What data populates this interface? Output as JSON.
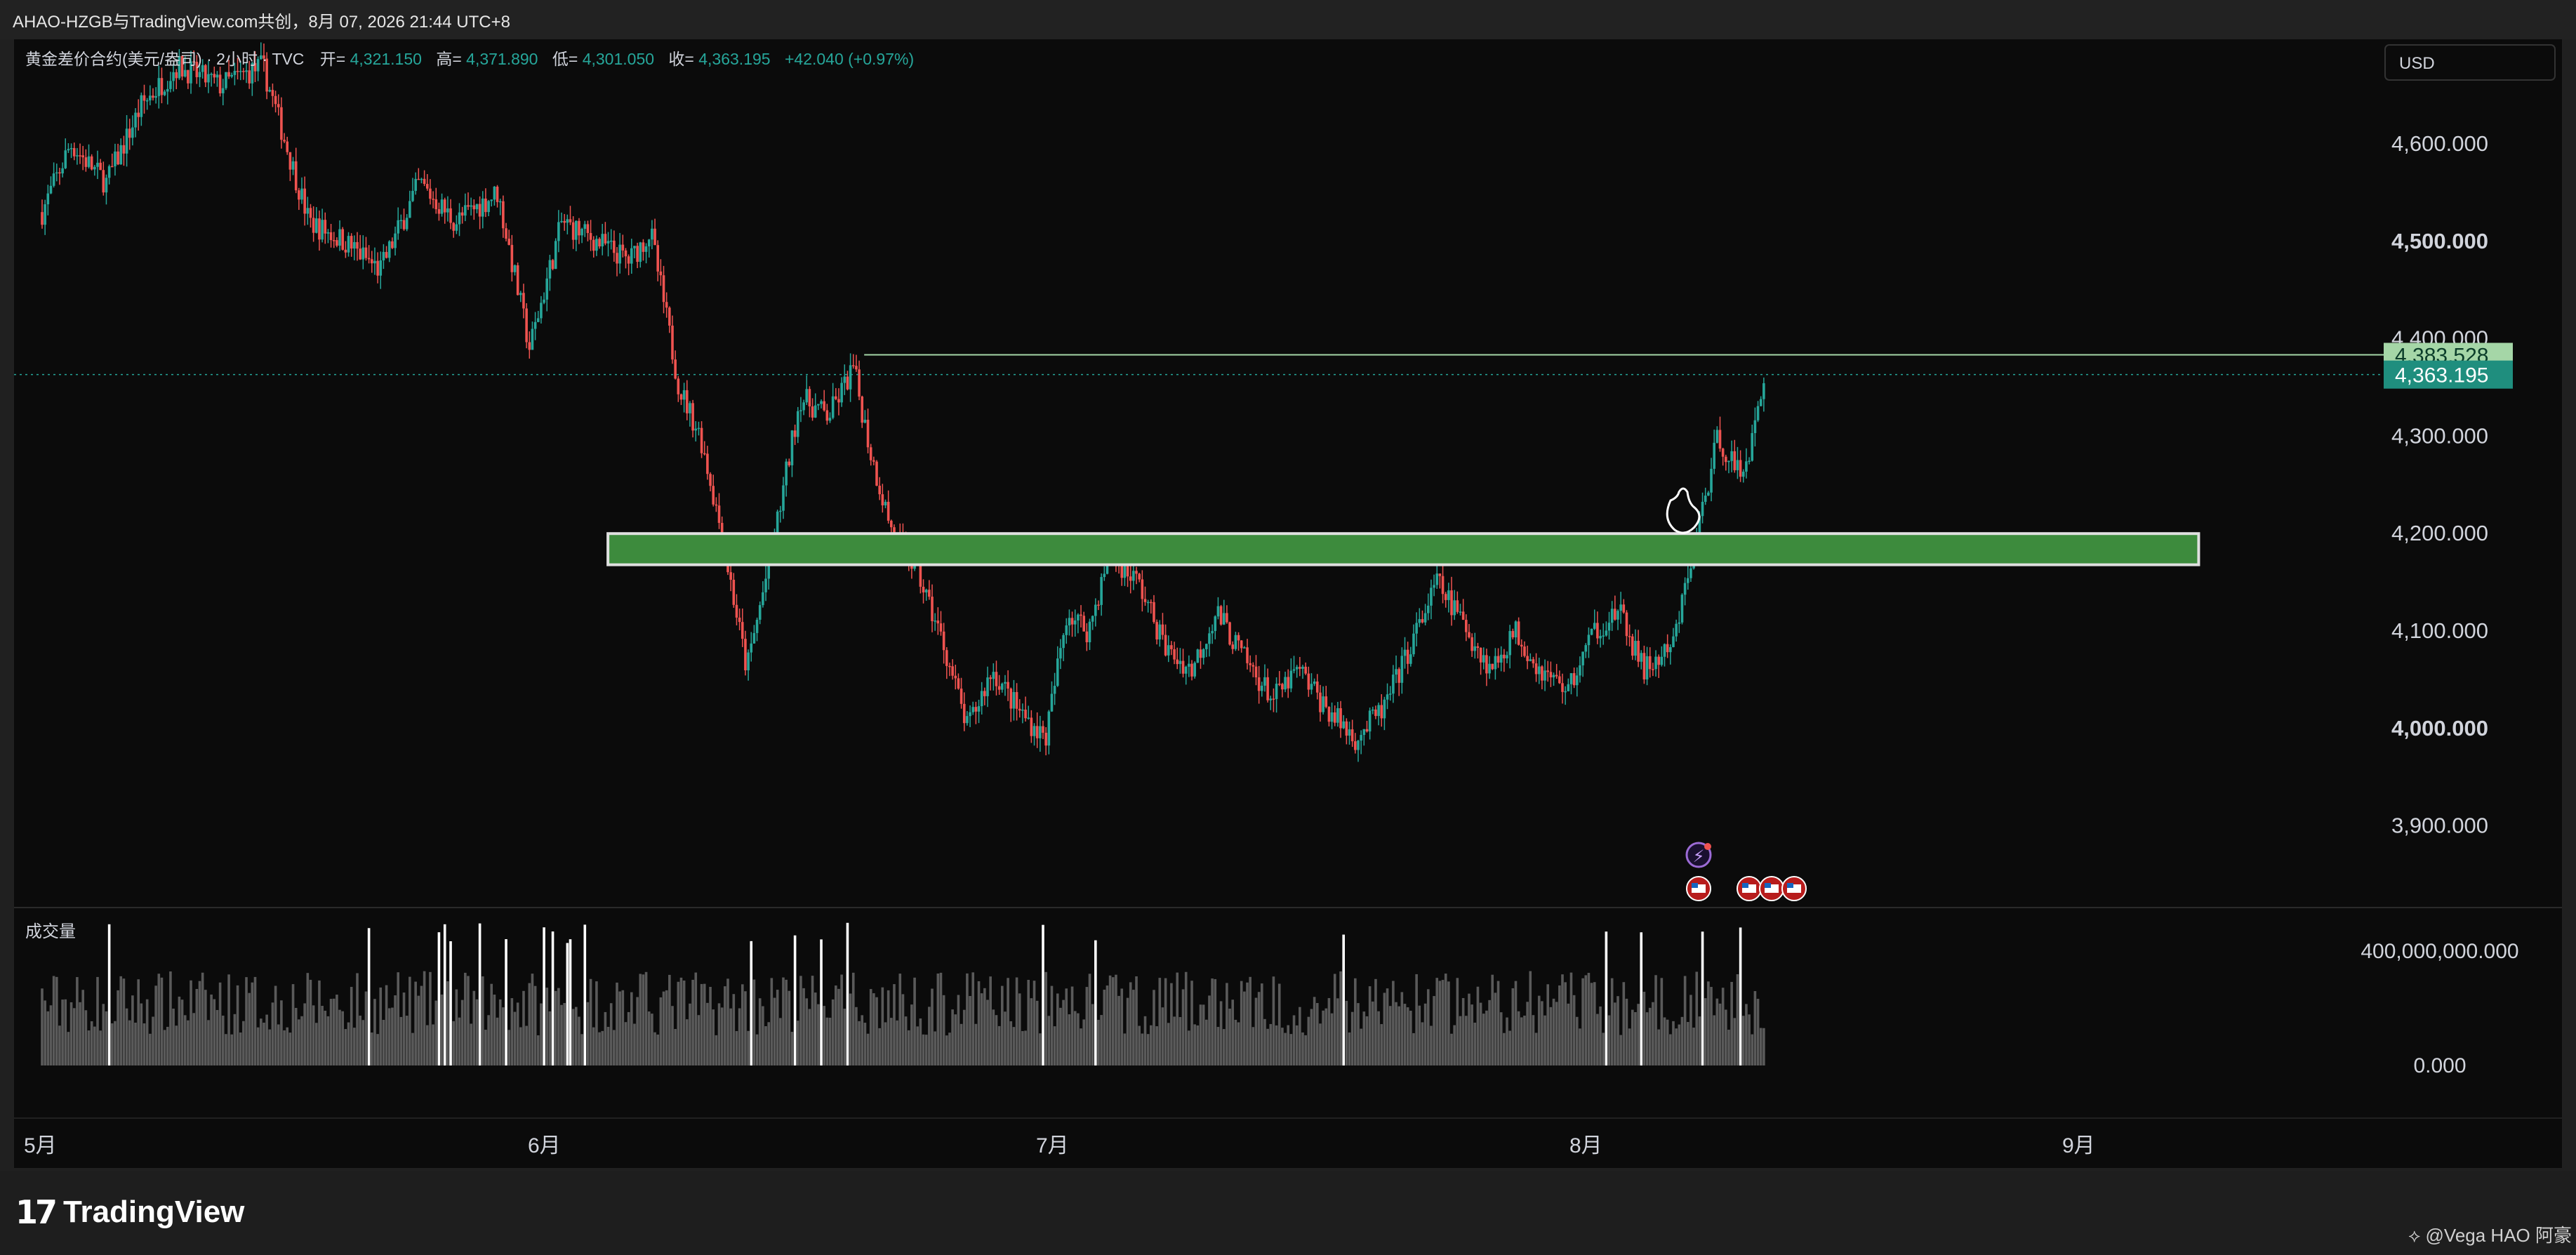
{
  "header": {
    "share_title": "AHAO-HZGB与TradingView.com共创，8月 07, 2026 21:44 UTC+8"
  },
  "legend": {
    "symbol": "黄金差价合约(美元/盎司) · 2小时 · TVC",
    "open_label": "开=",
    "open_value": "4,321.150",
    "high_label": "高=",
    "high_value": "4,371.890",
    "low_label": "低=",
    "low_value": "4,301.050",
    "close_label": "收=",
    "close_value": "4,363.195",
    "change": "+42.040 (+0.97%)"
  },
  "currency_box": "USD",
  "volume_label": "成交量",
  "colors": {
    "background": "#0b0b0b",
    "up": "#26a69a",
    "down": "#ef5350",
    "zone_fill": "#3d8b3d",
    "zone_border": "#e0e0e0",
    "resistance_line": "#a5d6a7",
    "last_price_bg": "#1f8e7e",
    "resistance_label_bg": "#a5d6a7"
  },
  "chart_data": [
    {
      "type": "candlestick",
      "interval": "2小时",
      "y_axis_ticks": [
        "3,900.000",
        "4,000.000",
        "4,100.000",
        "4,200.000",
        "4,300.000",
        "4,400.000",
        "4,500.000",
        "4,600.000"
      ],
      "y_tick_values": [
        3900,
        4000,
        4100,
        4200,
        4300,
        4400,
        4500,
        4600
      ],
      "ylim": [
        3840,
        4700
      ],
      "x_axis_ticks": [
        "5月",
        "6月",
        "7月",
        "8月",
        "9月"
      ],
      "price_path": [
        [
          0.0,
          4530
        ],
        [
          0.8,
          4600
        ],
        [
          1.8,
          4560
        ],
        [
          2.8,
          4640
        ],
        [
          3.8,
          4680
        ],
        [
          5.0,
          4660
        ],
        [
          6.2,
          4680
        ],
        [
          7.5,
          4520
        ],
        [
          8.5,
          4500
        ],
        [
          9.5,
          4470
        ],
        [
          10.6,
          4560
        ],
        [
          11.6,
          4520
        ],
        [
          12.8,
          4550
        ],
        [
          13.7,
          4390
        ],
        [
          14.6,
          4520
        ],
        [
          15.6,
          4500
        ],
        [
          16.5,
          4480
        ],
        [
          17.1,
          4510
        ],
        [
          17.9,
          4350
        ],
        [
          18.5,
          4300
        ],
        [
          19.1,
          4200
        ],
        [
          19.8,
          4060
        ],
        [
          20.6,
          4200
        ],
        [
          21.3,
          4340
        ],
        [
          22.1,
          4320
        ],
        [
          22.8,
          4370
        ],
        [
          23.3,
          4280
        ],
        [
          23.9,
          4200
        ],
        [
          24.6,
          4160
        ],
        [
          25.3,
          4090
        ],
        [
          26.0,
          4000
        ],
        [
          26.7,
          4060
        ],
        [
          27.4,
          4020
        ],
        [
          28.2,
          3990
        ],
        [
          28.8,
          4120
        ],
        [
          29.4,
          4100
        ],
        [
          30.0,
          4180
        ],
        [
          30.8,
          4150
        ],
        [
          31.6,
          4080
        ],
        [
          32.3,
          4060
        ],
        [
          33.0,
          4120
        ],
        [
          33.8,
          4070
        ],
        [
          34.6,
          4030
        ],
        [
          35.3,
          4060
        ],
        [
          36.1,
          4020
        ],
        [
          36.9,
          3990
        ],
        [
          37.7,
          4020
        ],
        [
          38.4,
          4080
        ],
        [
          39.2,
          4150
        ],
        [
          39.9,
          4110
        ],
        [
          40.7,
          4060
        ],
        [
          41.4,
          4100
        ],
        [
          42.1,
          4060
        ],
        [
          42.9,
          4040
        ],
        [
          43.6,
          4100
        ],
        [
          44.3,
          4120
        ],
        [
          45.0,
          4060
        ],
        [
          45.8,
          4080
        ],
        [
          46.5,
          4200
        ],
        [
          47.1,
          4300
        ],
        [
          47.7,
          4260
        ],
        [
          48.1,
          4300
        ],
        [
          48.4,
          4363
        ]
      ],
      "levels": [
        {
          "price": 4383.528,
          "label": "4,383.528"
        },
        {
          "price": 4363.195,
          "label": "4,363.195"
        }
      ],
      "zone": {
        "low": 4168,
        "high": 4200,
        "start_week": 15.9,
        "end_week": 60.6
      }
    },
    {
      "type": "bar",
      "series_name": "成交量",
      "y_axis_ticks": [
        "0.000",
        "400,000,000.000"
      ],
      "ylim": [
        0,
        520000000
      ],
      "typical_volume": 300000000,
      "spike_volume": 500000000
    }
  ]
}
